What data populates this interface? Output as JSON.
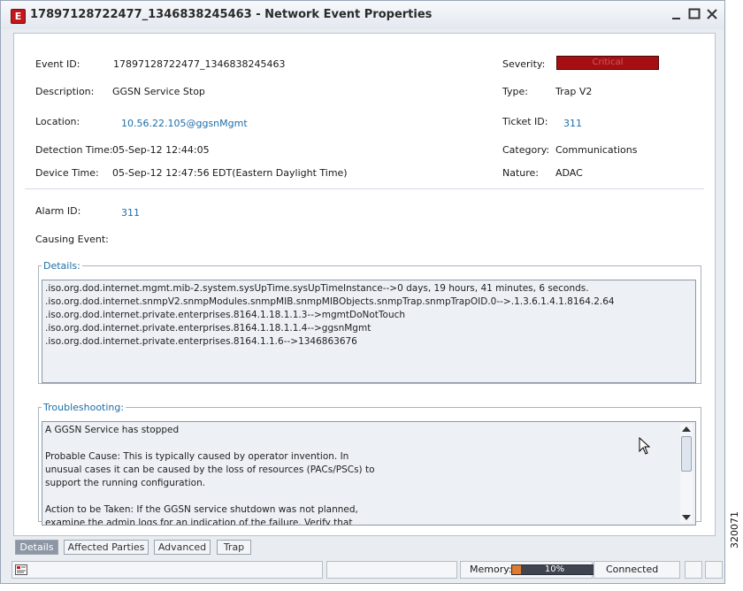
{
  "window": {
    "title": "17897128722477_1346838245463 - Network Event Properties",
    "app_icon": "E"
  },
  "fields": {
    "event_id_label": "Event ID:",
    "event_id": "17897128722477_1346838245463",
    "description_label": "Description:",
    "description": "GGSN Service Stop",
    "location_label": "Location:",
    "location": "10.56.22.105@ggsnMgmt",
    "detection_time_label": "Detection Time:",
    "detection_time": "05-Sep-12 12:44:05",
    "device_time_label": "Device Time:",
    "device_time": "05-Sep-12 12:47:56 EDT(Eastern Daylight Time)",
    "severity_label": "Severity:",
    "severity": "Critical",
    "severity_color": "#a50f13",
    "type_label": "Type:",
    "type": "Trap V2",
    "ticket_id_label": "Ticket ID:",
    "ticket_id": "311",
    "category_label": "Category:",
    "category": "Communications",
    "nature_label": "Nature:",
    "nature": "ADAC",
    "alarm_id_label": "Alarm ID:",
    "alarm_id": "311",
    "causing_event_label": "Causing Event:"
  },
  "details": {
    "legend": "Details:",
    "lines": [
      ".iso.org.dod.internet.mgmt.mib-2.system.sysUpTime.sysUpTimeInstance-->0 days, 19 hours, 41 minutes, 6 seconds.",
      ".iso.org.dod.internet.snmpV2.snmpModules.snmpMIB.snmpMIBObjects.snmpTrap.snmpTrapOID.0-->.1.3.6.1.4.1.8164.2.64",
      ".iso.org.dod.internet.private.enterprises.8164.1.18.1.1.3-->mgmtDoNotTouch",
      ".iso.org.dod.internet.private.enterprises.8164.1.18.1.1.4-->ggsnMgmt",
      ".iso.org.dod.internet.private.enterprises.8164.1.1.6-->1346863676"
    ]
  },
  "troubleshooting": {
    "legend": "Troubleshooting:",
    "lines": [
      "A GGSN Service has stopped",
      "",
      "Probable Cause: This is typically caused by operator invention. In",
      "unusual cases it can be caused by the loss of resources (PACs/PSCs) to",
      "support the running configuration.",
      "",
      "Action to be Taken: If the GGSN service shutdown was not planned,",
      "examine the admin logs for an indication of the failure. Verify that"
    ]
  },
  "tabs": [
    "Details",
    "Affected Parties",
    "Advanced",
    "Trap"
  ],
  "status": {
    "memory_label": "Memory:",
    "memory_percent": "10%",
    "memory_fraction": 0.1,
    "connection": "Connected"
  },
  "figure_id": "320071"
}
